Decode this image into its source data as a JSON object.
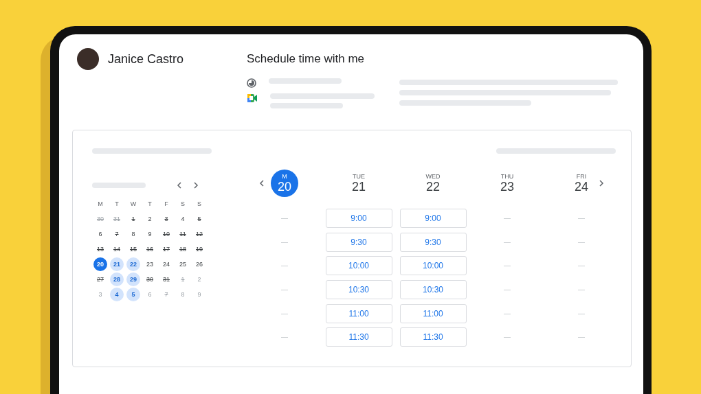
{
  "host": {
    "name": "Janice Castro"
  },
  "page": {
    "title": "Schedule time with me"
  },
  "mini_calendar": {
    "weekdays": [
      "M",
      "T",
      "W",
      "T",
      "F",
      "S",
      "S"
    ],
    "weeks": [
      [
        {
          "day": "30",
          "struck": true,
          "muted": true,
          "available": false,
          "selected": false
        },
        {
          "day": "31",
          "struck": true,
          "muted": true,
          "available": false,
          "selected": false
        },
        {
          "day": "1",
          "struck": true,
          "muted": false,
          "available": false,
          "selected": false
        },
        {
          "day": "2",
          "struck": false,
          "muted": false,
          "available": false,
          "selected": false
        },
        {
          "day": "3",
          "struck": true,
          "muted": false,
          "available": false,
          "selected": false
        },
        {
          "day": "4",
          "struck": false,
          "muted": false,
          "available": false,
          "selected": false
        },
        {
          "day": "5",
          "struck": true,
          "muted": false,
          "available": false,
          "selected": false
        }
      ],
      [
        {
          "day": "6",
          "struck": false,
          "muted": false,
          "available": false,
          "selected": false
        },
        {
          "day": "7",
          "struck": true,
          "muted": false,
          "available": false,
          "selected": false
        },
        {
          "day": "8",
          "struck": false,
          "muted": false,
          "available": false,
          "selected": false
        },
        {
          "day": "9",
          "struck": false,
          "muted": false,
          "available": false,
          "selected": false
        },
        {
          "day": "10",
          "struck": true,
          "muted": false,
          "available": false,
          "selected": false
        },
        {
          "day": "11",
          "struck": true,
          "muted": false,
          "available": false,
          "selected": false
        },
        {
          "day": "12",
          "struck": true,
          "muted": false,
          "available": false,
          "selected": false
        }
      ],
      [
        {
          "day": "13",
          "struck": true,
          "muted": false,
          "available": false,
          "selected": false
        },
        {
          "day": "14",
          "struck": true,
          "muted": false,
          "available": false,
          "selected": false
        },
        {
          "day": "15",
          "struck": true,
          "muted": false,
          "available": false,
          "selected": false
        },
        {
          "day": "16",
          "struck": true,
          "muted": false,
          "available": false,
          "selected": false
        },
        {
          "day": "17",
          "struck": true,
          "muted": false,
          "available": false,
          "selected": false
        },
        {
          "day": "18",
          "struck": true,
          "muted": false,
          "available": false,
          "selected": false
        },
        {
          "day": "19",
          "struck": true,
          "muted": false,
          "available": false,
          "selected": false
        }
      ],
      [
        {
          "day": "20",
          "struck": false,
          "muted": false,
          "available": true,
          "selected": true
        },
        {
          "day": "21",
          "struck": false,
          "muted": false,
          "available": true,
          "selected": false
        },
        {
          "day": "22",
          "struck": false,
          "muted": false,
          "available": true,
          "selected": false
        },
        {
          "day": "23",
          "struck": false,
          "muted": false,
          "available": false,
          "selected": false
        },
        {
          "day": "24",
          "struck": false,
          "muted": false,
          "available": false,
          "selected": false
        },
        {
          "day": "25",
          "struck": false,
          "muted": false,
          "available": false,
          "selected": false
        },
        {
          "day": "26",
          "struck": false,
          "muted": false,
          "available": false,
          "selected": false
        }
      ],
      [
        {
          "day": "27",
          "struck": true,
          "muted": false,
          "available": false,
          "selected": false
        },
        {
          "day": "28",
          "struck": false,
          "muted": false,
          "available": true,
          "selected": false
        },
        {
          "day": "29",
          "struck": false,
          "muted": false,
          "available": true,
          "selected": false
        },
        {
          "day": "30",
          "struck": true,
          "muted": false,
          "available": false,
          "selected": false
        },
        {
          "day": "31",
          "struck": true,
          "muted": false,
          "available": false,
          "selected": false
        },
        {
          "day": "1",
          "struck": true,
          "muted": true,
          "available": false,
          "selected": false
        },
        {
          "day": "2",
          "struck": false,
          "muted": true,
          "available": false,
          "selected": false
        }
      ],
      [
        {
          "day": "3",
          "struck": false,
          "muted": true,
          "available": false,
          "selected": false
        },
        {
          "day": "4",
          "struck": false,
          "muted": false,
          "available": true,
          "selected": false
        },
        {
          "day": "5",
          "struck": false,
          "muted": false,
          "available": true,
          "selected": false
        },
        {
          "day": "6",
          "struck": false,
          "muted": true,
          "available": false,
          "selected": false
        },
        {
          "day": "7",
          "struck": true,
          "muted": true,
          "available": false,
          "selected": false
        },
        {
          "day": "8",
          "struck": false,
          "muted": true,
          "available": false,
          "selected": false
        },
        {
          "day": "9",
          "struck": false,
          "muted": true,
          "available": false,
          "selected": false
        }
      ]
    ]
  },
  "week": {
    "days": [
      {
        "weekday": "M",
        "date": "20",
        "selected": true,
        "slots": [
          {
            "kind": "none",
            "label": "—"
          },
          {
            "kind": "none",
            "label": "—"
          },
          {
            "kind": "none",
            "label": "—"
          },
          {
            "kind": "none",
            "label": "—"
          },
          {
            "kind": "none",
            "label": "—"
          },
          {
            "kind": "none",
            "label": "—"
          }
        ]
      },
      {
        "weekday": "TUE",
        "date": "21",
        "selected": false,
        "slots": [
          {
            "kind": "slot",
            "label": "9:00"
          },
          {
            "kind": "slot",
            "label": "9:30"
          },
          {
            "kind": "slot",
            "label": "10:00"
          },
          {
            "kind": "slot",
            "label": "10:30"
          },
          {
            "kind": "slot",
            "label": "11:00"
          },
          {
            "kind": "slot",
            "label": "11:30"
          }
        ]
      },
      {
        "weekday": "WED",
        "date": "22",
        "selected": false,
        "slots": [
          {
            "kind": "slot",
            "label": "9:00"
          },
          {
            "kind": "slot",
            "label": "9:30"
          },
          {
            "kind": "slot",
            "label": "10:00"
          },
          {
            "kind": "slot",
            "label": "10:30"
          },
          {
            "kind": "slot",
            "label": "11:00"
          },
          {
            "kind": "slot",
            "label": "11:30"
          }
        ]
      },
      {
        "weekday": "THU",
        "date": "23",
        "selected": false,
        "slots": [
          {
            "kind": "none",
            "label": "—"
          },
          {
            "kind": "none",
            "label": "—"
          },
          {
            "kind": "none",
            "label": "—"
          },
          {
            "kind": "none",
            "label": "—"
          },
          {
            "kind": "none",
            "label": "—"
          },
          {
            "kind": "none",
            "label": "—"
          }
        ]
      },
      {
        "weekday": "FRI",
        "date": "24",
        "selected": false,
        "slots": [
          {
            "kind": "none",
            "label": "—"
          },
          {
            "kind": "none",
            "label": "—"
          },
          {
            "kind": "none",
            "label": "—"
          },
          {
            "kind": "none",
            "label": "—"
          },
          {
            "kind": "none",
            "label": "—"
          },
          {
            "kind": "none",
            "label": "—"
          }
        ]
      }
    ]
  }
}
